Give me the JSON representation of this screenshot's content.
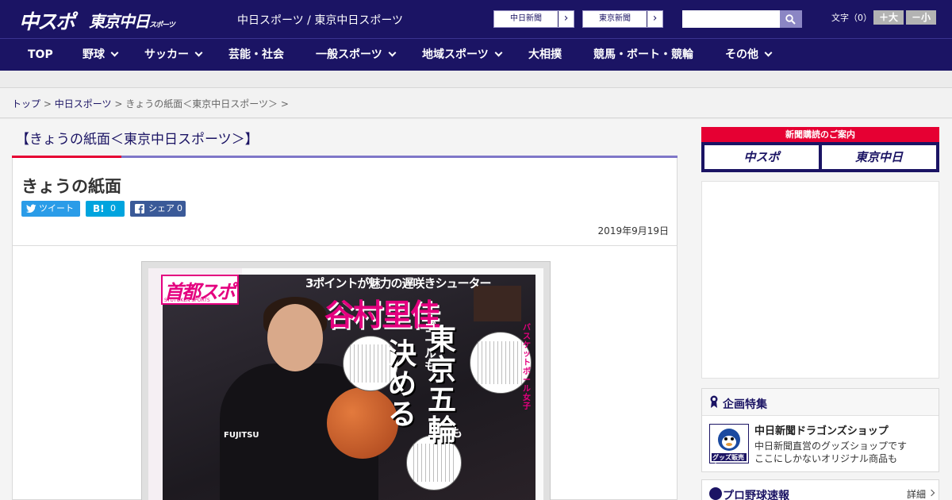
{
  "header": {
    "logo_chusupo": "中スポ",
    "logo_tokyo": "東京中日",
    "logo_tokyo_small": "スポーツ",
    "site_title": "中日スポーツ / 東京中日スポーツ",
    "paper_links": [
      {
        "label": "中日新聞"
      },
      {
        "label": "東京新聞"
      }
    ],
    "search_placeholder": "",
    "fontsize_label": "文字（0）",
    "fontsize_up": "＋大",
    "fontsize_down": "－小"
  },
  "nav": {
    "items": [
      {
        "label": "TOP"
      },
      {
        "label": "野球"
      },
      {
        "label": "サッカー"
      },
      {
        "label": "芸能・社会"
      },
      {
        "label": "一般スポーツ"
      },
      {
        "label": "地域スポーツ"
      },
      {
        "label": "大相撲"
      },
      {
        "label": "競馬・ボート・競輪"
      },
      {
        "label": "その他"
      }
    ]
  },
  "breadcrumb": {
    "items": [
      "トップ",
      "中日スポーツ",
      "きょうの紙面＜東京中日スポーツ＞"
    ],
    "separator": ">"
  },
  "main": {
    "section_heading": "【きょうの紙面＜東京中日スポーツ＞】",
    "article_title": "きょうの紙面",
    "share": {
      "tweet": "ツイート",
      "hatena_count": "0",
      "facebook": "シェア",
      "facebook_count": "0"
    },
    "date": "2019年9月19日",
    "newspaper": {
      "brand": "首都スポ",
      "brand_en": "SYUTOKEN SPORTS",
      "tagline": "3ポイントが魅力の遅咲きシューター",
      "name": "谷村里佳",
      "headline_sub1": "ゴールも",
      "headline_a": "東京五輪",
      "headline_b": "決める",
      "headline_sub2": "も",
      "jersey_logo": "FUJITSU",
      "vertical_text": "バスケットボール女子"
    }
  },
  "sidebar": {
    "subscribe_bar": "新聞購読のご案内",
    "subscribe_chusupo": "中スポ",
    "subscribe_tokyo": "東京中日",
    "feature": {
      "title": "企画特集",
      "shop_title": "中日新聞ドラゴンズショップ",
      "shop_desc1": "中日新聞直営のグッズショップです",
      "shop_desc2": "ここにしかないオリジナル商品も",
      "shop_thumb_label": "グッズ販売中"
    },
    "baseball": {
      "title": "プロ野球速報",
      "more": "詳細"
    }
  },
  "colors": {
    "brand_navy": "#1b1464",
    "accent_red": "#e60033",
    "accent_purple": "#7f77c8",
    "twitter": "#2a9ce8",
    "hatena": "#00a4de",
    "facebook": "#3b5a98"
  }
}
